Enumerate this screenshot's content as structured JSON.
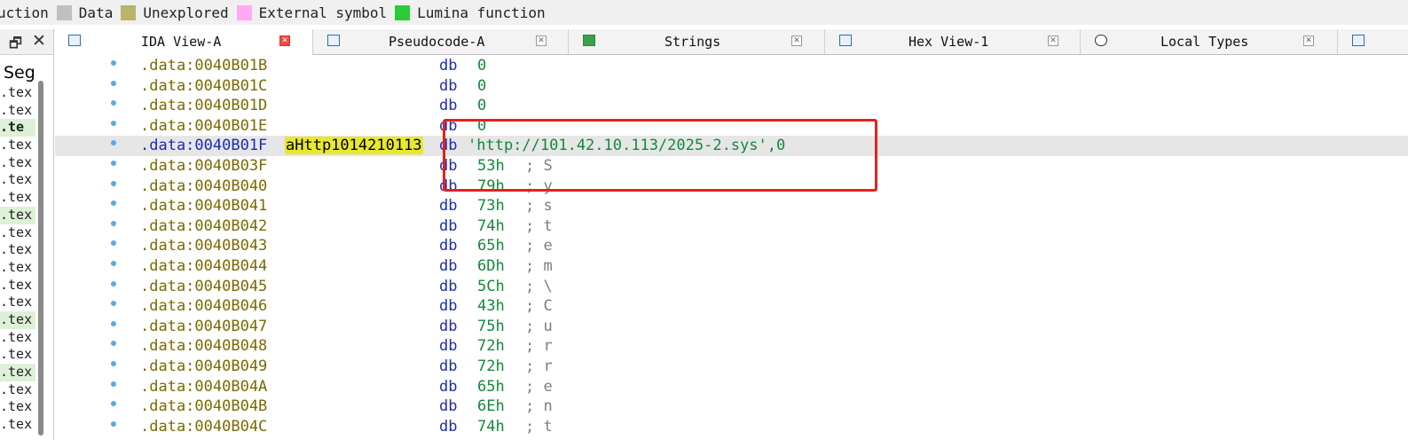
{
  "legend": [
    {
      "label": "uction",
      "color": null
    },
    {
      "label": "Data",
      "color": "#c0c0c0"
    },
    {
      "label": "Unexplored",
      "color": "#b8b46a"
    },
    {
      "label": "External symbol",
      "color": "#ffaaf2"
    },
    {
      "label": "Lumina function",
      "color": "#2ccc36"
    }
  ],
  "left_panel": {
    "title": "Seg",
    "rows": [
      ".tex",
      ".tex",
      ".te",
      ".tex",
      ".tex",
      ".tex",
      ".tex",
      ".tex",
      ".tex",
      ".tex",
      ".tex",
      ".tex",
      ".tex",
      ".tex",
      ".tex",
      ".tex",
      ".tex",
      ".tex",
      ".tex",
      ".tex"
    ]
  },
  "tabs": [
    {
      "label": "IDA View-A",
      "icon": "ida-view-icon",
      "active": true
    },
    {
      "label": "Pseudocode-A",
      "icon": "pseudocode-icon",
      "active": false
    },
    {
      "label": "Strings",
      "icon": "strings-icon",
      "active": false
    },
    {
      "label": "Hex View-1",
      "icon": "hex-view-icon",
      "active": false
    },
    {
      "label": "Local Types",
      "icon": "local-types-icon",
      "active": false
    }
  ],
  "listing": [
    {
      "addr": ".data:0040B01B",
      "label": "",
      "mnemonic": "db",
      "operand": "0",
      "comment": ""
    },
    {
      "addr": ".data:0040B01C",
      "label": "",
      "mnemonic": "db",
      "operand": "0",
      "comment": ""
    },
    {
      "addr": ".data:0040B01D",
      "label": "",
      "mnemonic": "db",
      "operand": "0",
      "comment": ""
    },
    {
      "addr": ".data:0040B01E",
      "label": "",
      "mnemonic": "db",
      "operand": "0",
      "comment": ""
    },
    {
      "addr": ".data:0040B01F",
      "label": "aHttp1014210113",
      "mnemonic": "db",
      "operand": "'http://101.42.10.113/2025-2.sys',0",
      "comment": ""
    },
    {
      "addr": ".data:0040B03F",
      "label": "",
      "mnemonic": "db",
      "operand": "53h",
      "comment": "; S"
    },
    {
      "addr": ".data:0040B040",
      "label": "",
      "mnemonic": "db",
      "operand": "79h",
      "comment": "; y"
    },
    {
      "addr": ".data:0040B041",
      "label": "",
      "mnemonic": "db",
      "operand": "73h",
      "comment": "; s"
    },
    {
      "addr": ".data:0040B042",
      "label": "",
      "mnemonic": "db",
      "operand": "74h",
      "comment": "; t"
    },
    {
      "addr": ".data:0040B043",
      "label": "",
      "mnemonic": "db",
      "operand": "65h",
      "comment": "; e"
    },
    {
      "addr": ".data:0040B044",
      "label": "",
      "mnemonic": "db",
      "operand": "6Dh",
      "comment": "; m"
    },
    {
      "addr": ".data:0040B045",
      "label": "",
      "mnemonic": "db",
      "operand": "5Ch",
      "comment": "; \\"
    },
    {
      "addr": ".data:0040B046",
      "label": "",
      "mnemonic": "db",
      "operand": "43h",
      "comment": "; C"
    },
    {
      "addr": ".data:0040B047",
      "label": "",
      "mnemonic": "db",
      "operand": "75h",
      "comment": "; u"
    },
    {
      "addr": ".data:0040B048",
      "label": "",
      "mnemonic": "db",
      "operand": "72h",
      "comment": "; r"
    },
    {
      "addr": ".data:0040B049",
      "label": "",
      "mnemonic": "db",
      "operand": "72h",
      "comment": "; r"
    },
    {
      "addr": ".data:0040B04A",
      "label": "",
      "mnemonic": "db",
      "operand": "65h",
      "comment": "; e"
    },
    {
      "addr": ".data:0040B04B",
      "label": "",
      "mnemonic": "db",
      "operand": "6Eh",
      "comment": "; n"
    },
    {
      "addr": ".data:0040B04C",
      "label": "",
      "mnemonic": "db",
      "operand": "74h",
      "comment": "; t"
    }
  ],
  "highlight_color": "#e8201c"
}
